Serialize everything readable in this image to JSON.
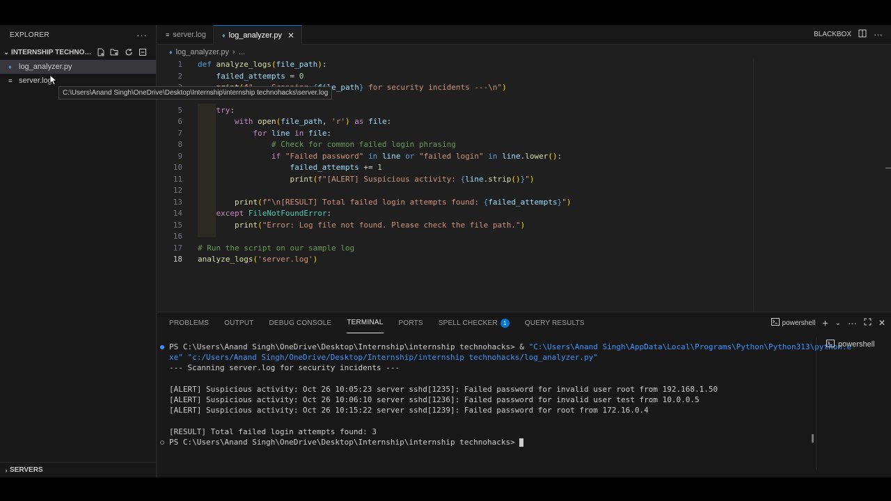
{
  "sidebar": {
    "title": "EXPLORER",
    "folder_name": "INTERNSHIP TECHNOHA...",
    "files": [
      {
        "name": "log_analyzer.py"
      },
      {
        "name": "server.log"
      }
    ],
    "servers_label": "SERVERS",
    "tooltip": "C:\\Users\\Anand Singh\\OneDrive\\Desktop\\Internship\\internship technohacks\\server.log"
  },
  "tabs": [
    {
      "label": "server.log"
    },
    {
      "label": "log_analyzer.py"
    }
  ],
  "top_right": {
    "blackbox": "BLACKBOX"
  },
  "breadcrumb": {
    "file": "log_analyzer.py",
    "more": "..."
  },
  "editor": {
    "line_numbers": [
      "1",
      "2",
      "3",
      "5",
      "6",
      "7",
      "8",
      "9",
      "10",
      "11",
      "12",
      "13",
      "14",
      "15",
      "16",
      "17",
      "18"
    ],
    "current_line": "18"
  },
  "panel": {
    "tabs": [
      "PROBLEMS",
      "OUTPUT",
      "DEBUG CONSOLE",
      "TERMINAL",
      "PORTS",
      "SPELL CHECKER",
      "QUERY RESULTS"
    ],
    "spell_badge": "1",
    "shell_label": "powershell",
    "terminal_list_item": "powershell",
    "terminal": {
      "cmd_prefix": "PS C:\\Users\\Anand Singh\\OneDrive\\Desktop\\Internship\\internship technohacks> & ",
      "cmd_exe_a": "\"C:\\Users\\Anand Singh\\AppData\\Local\\Programs\\Python\\Python313\\python.e",
      "cmd_exe_b": "xe\"",
      "cmd_script": " \"c:/Users/Anand Singh/OneDrive/Desktop/Internship/internship technohacks/log_analyzer.py\"",
      "scanning": "--- Scanning server.log for security incidents ---",
      "alerts": [
        "[ALERT] Suspicious activity: Oct 26 10:05:23 server sshd[1235]: Failed password for invalid user root from 192.168.1.50",
        "[ALERT] Suspicious activity: Oct 26 10:06:10 server sshd[1236]: Failed password for invalid user test from 10.0.0.5",
        "[ALERT] Suspicious activity: Oct 26 10:15:22 server sshd[1239]: Failed password for root from 172.16.0.4"
      ],
      "result": "[RESULT] Total failed login attempts found: 3",
      "prompt": "PS C:\\Users\\Anand Singh\\OneDrive\\Desktop\\Internship\\internship technohacks> "
    }
  }
}
